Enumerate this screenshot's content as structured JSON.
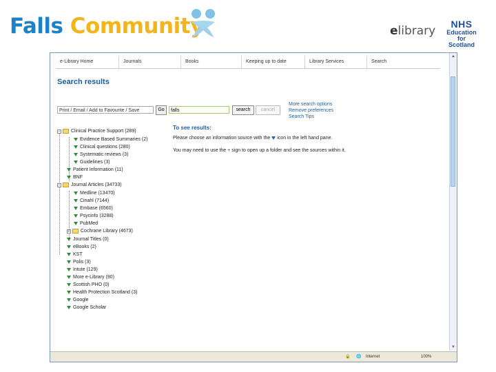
{
  "banner": {
    "title_part1": "Falls",
    "title_part2": "Community",
    "elibrary_prefix": "e",
    "elibrary_suffix": "library",
    "nhs_line1": "NHS",
    "nhs_line2": "Education",
    "nhs_line3": "for",
    "nhs_line4": "Scotland"
  },
  "nav": {
    "items": [
      "e-Library Home",
      "Journals",
      "Books",
      "Keeping up to date",
      "Library Services",
      "Search"
    ]
  },
  "page": {
    "title": "Search results"
  },
  "toolbar": {
    "action_select": "Print / Email / Add to Favourite / Save",
    "go_label": "Go",
    "search_value": "falls",
    "search_label": "search",
    "cancel_label": "cancel"
  },
  "side_links": [
    "More search options",
    "Remove preferences",
    "Search Tips"
  ],
  "tree": [
    {
      "label": "Clinical Practice Support (289)"
    },
    {
      "label": "Evidence Based Summaries (2)"
    },
    {
      "label": "Clinical questions (280)"
    },
    {
      "label": "Systematic reviews (3)"
    },
    {
      "label": "Guidelines (3)"
    },
    {
      "label": "Patient Information (11)"
    },
    {
      "label": "BNF"
    },
    {
      "label": "Journal Articles (34733)"
    },
    {
      "label": "Medline (13470)"
    },
    {
      "label": "Cinahl (7144)"
    },
    {
      "label": "Embase (6560)"
    },
    {
      "label": "Psycinfo (3288)"
    },
    {
      "label": "PubMed"
    },
    {
      "label": "Cochrane Library (4673)"
    },
    {
      "label": "Journal Titles (0)"
    },
    {
      "label": "eBooks (2)"
    },
    {
      "label": "KST"
    },
    {
      "label": "Polis (3)"
    },
    {
      "label": "Intute (129)"
    },
    {
      "label": "More e-Library (90)"
    },
    {
      "label": "Scottish PHO (0)"
    },
    {
      "label": "Health Protection Scotland (3)"
    },
    {
      "label": "Google"
    },
    {
      "label": "Google Scholar"
    }
  ],
  "instructions": {
    "title": "To see results:",
    "line1_a": "Please choose an information source with the",
    "line1_b": "icon in the left hand pane.",
    "line2_a": "You may need to use the",
    "line2_b": "sign to open up a folder and see the sources within it."
  },
  "status": {
    "zone": "Internet",
    "zoom": "100%"
  },
  "colors": {
    "falls_blue": "#1e82c6",
    "community_yellow": "#f2b51c",
    "link_blue": "#1e5c9c",
    "filter_green": "#2e8b3a"
  }
}
